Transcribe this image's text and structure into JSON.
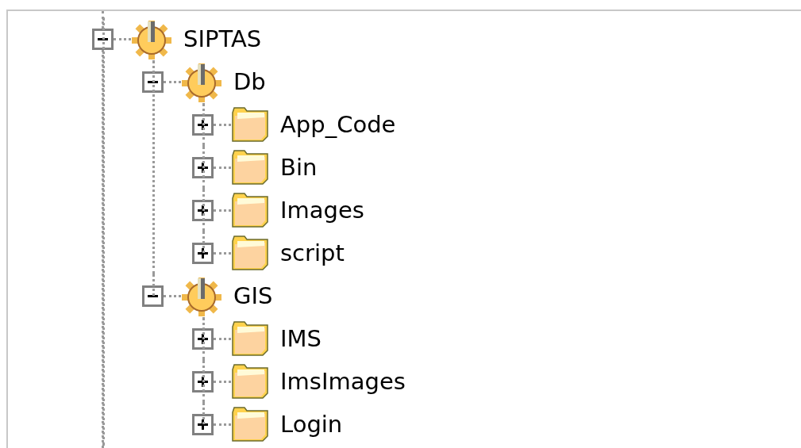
{
  "tree": [
    {
      "label": "SIPTAS",
      "kind": "site",
      "expanded": true,
      "children": [
        {
          "label": "Db",
          "kind": "site",
          "expanded": true,
          "children": [
            {
              "label": "App_Code",
              "kind": "folder",
              "expanded": false
            },
            {
              "label": "Bin",
              "kind": "folder",
              "expanded": false
            },
            {
              "label": "Images",
              "kind": "folder",
              "expanded": false
            },
            {
              "label": "script",
              "kind": "folder",
              "expanded": false
            }
          ]
        },
        {
          "label": "GIS",
          "kind": "site",
          "expanded": true,
          "children": [
            {
              "label": "IMS",
              "kind": "folder",
              "expanded": false
            },
            {
              "label": "ImsImages",
              "kind": "folder",
              "expanded": false
            },
            {
              "label": "Login",
              "kind": "folder",
              "expanded": false
            }
          ]
        }
      ]
    }
  ]
}
